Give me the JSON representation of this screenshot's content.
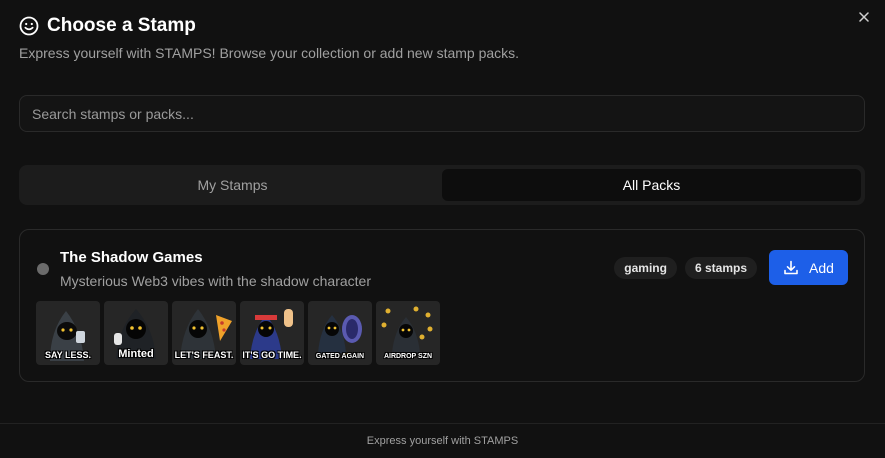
{
  "dialog": {
    "title": "Choose a Stamp",
    "subtitle": "Express yourself with STAMPS! Browse your collection or add new stamp packs.",
    "icon": "smile-icon",
    "close_icon": "close-icon"
  },
  "search": {
    "placeholder": "Search stamps or packs...",
    "value": ""
  },
  "tabs": [
    {
      "label": "My Stamps",
      "active": false
    },
    {
      "label": "All Packs",
      "active": true
    }
  ],
  "pack": {
    "name": "The Shadow Games",
    "description": "Mysterious Web3 vibes with the shadow character",
    "tag": "gaming",
    "count": "6 stamps",
    "add_label": "Add",
    "stamps": [
      {
        "label": "SAY LESS."
      },
      {
        "label": "Minted"
      },
      {
        "label": "LET'S FEAST."
      },
      {
        "label": "IT'S GO TIME."
      },
      {
        "label": "GATED AGAIN"
      },
      {
        "label": "AIRDROP SZN"
      }
    ]
  },
  "footer": {
    "text": "Express yourself with STAMPS"
  },
  "colors": {
    "background": "#111111",
    "accent": "#1d5fe8",
    "muted_text": "#a0a0a0"
  }
}
